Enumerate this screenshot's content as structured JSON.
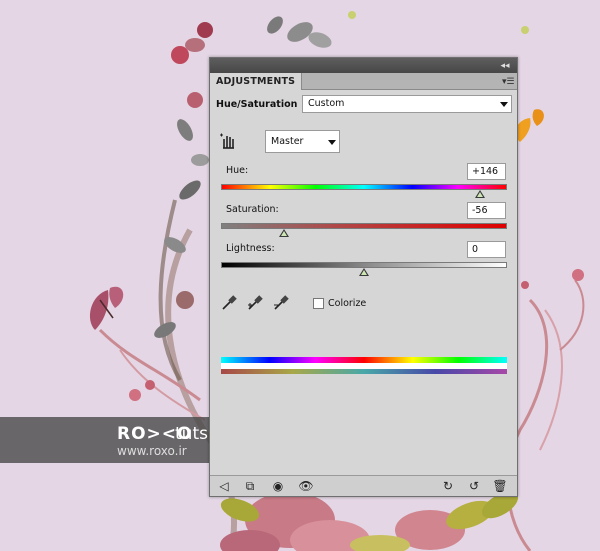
{
  "panel": {
    "tab_label": "ADJUSTMENTS",
    "adjustment_name": "Hue/Saturation",
    "preset_value": "Custom",
    "channel_value": "Master",
    "sliders": {
      "hue": {
        "label": "Hue:",
        "value": "+146",
        "thumb_fraction": 0.905
      },
      "saturation": {
        "label": "Saturation:",
        "value": "-56",
        "thumb_fraction": 0.22
      },
      "lightness": {
        "label": "Lightness:",
        "value": "0",
        "thumb_fraction": 0.5
      }
    },
    "colorize_label": "Colorize",
    "colorize_checked": false
  },
  "watermark": {
    "logo": "RO><O",
    "tuts": "tuts",
    "url": "www.roxo.ir"
  },
  "colors": {
    "background": "#e4d6e4",
    "panel_bg": "#d6d6d6",
    "titlebar": "#4a4a4a"
  }
}
